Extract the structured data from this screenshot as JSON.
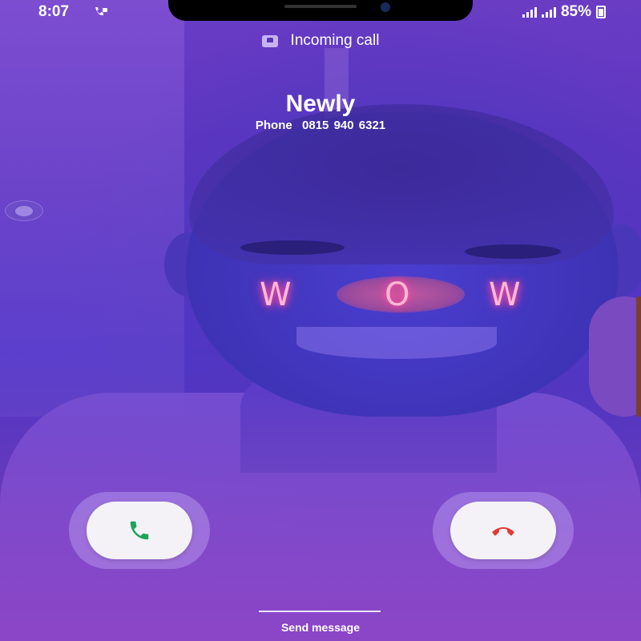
{
  "status_bar": {
    "time": "8:07",
    "battery": "85%",
    "icons": [
      "call-forward-icon",
      "signal-icon",
      "signal-icon",
      "battery-icon"
    ]
  },
  "call": {
    "status_label": "Incoming call",
    "caller_name": "Newly",
    "caller_number": "Phone  0815 940 6321"
  },
  "overlay": {
    "letters": [
      "W",
      "O",
      "W"
    ]
  },
  "actions": {
    "accept_icon": "phone-accept-icon",
    "decline_icon": "phone-decline-icon",
    "send_message_label": "Send message"
  },
  "colors": {
    "accept": "#1fa35a",
    "decline": "#e53935",
    "background": "#5a34c0"
  }
}
